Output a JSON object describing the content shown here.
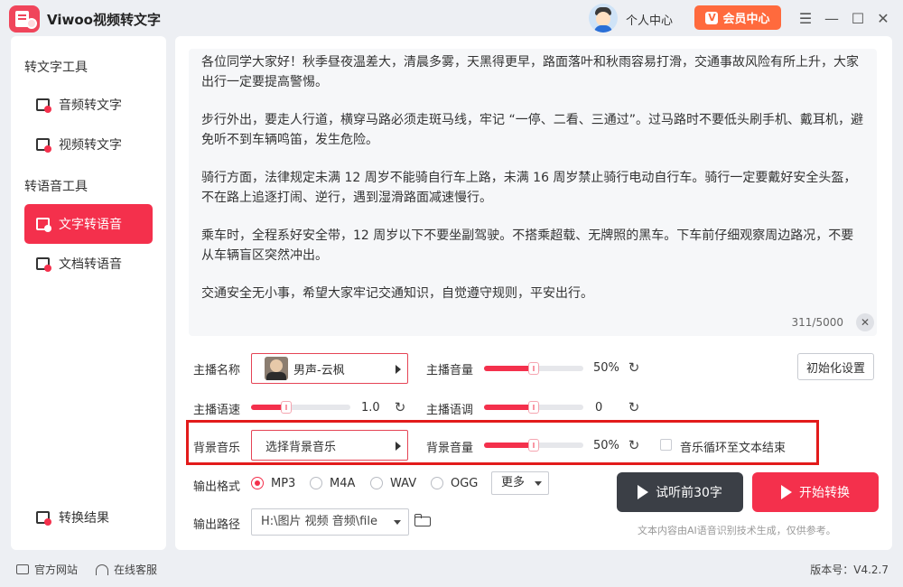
{
  "app": {
    "title": "Viwoo视频转文字"
  },
  "header": {
    "user_center": "个人中心",
    "vip": "会员中心",
    "vip_glyph": "V"
  },
  "window_controls": {
    "menu": "☰",
    "minimize": "—",
    "maximize": "☐",
    "close": "✕"
  },
  "sidebar": {
    "section_1": "转文字工具",
    "item_audio": "音频转文字",
    "item_video": "视频转文字",
    "section_2": "转语音工具",
    "item_text_tts": "文字转语音",
    "item_doc_tts": "文档转语音",
    "item_results": "转换结果"
  },
  "editor": {
    "paragraphs": [
      "各位同学大家好！秋季昼夜温差大，清晨多雾，天黑得更早，路面落叶和秋雨容易打滑，交通事故风险有所上升，大家出行一定要提高警惕。",
      "步行外出，要走人行道，横穿马路必须走斑马线，牢记 “一停、二看、三通过”。过马路时不要低头刷手机、戴耳机，避免听不到车辆鸣笛，发生危险。",
      "骑行方面，法律规定未满 12 周岁不能骑自行车上路，未满 16 周岁禁止骑行电动自行车。骑行一定要戴好安全头盔，不在路上追逐打闹、逆行，遇到湿滑路面减速慢行。",
      "乘车时，全程系好安全带，12 周岁以下不要坐副驾驶。不搭乘超载、无牌照的黑车。下车前仔细观察周边路况，不要从车辆盲区突然冲出。",
      "交通安全无小事，希望大家牢记交通知识，自觉遵守规则，平安出行。"
    ],
    "counter": "311/5000",
    "clear_glyph": "✕"
  },
  "settings": {
    "anchor_label": "主播名称",
    "anchor_value": "男声-云枫",
    "anchor_volume_label": "主播音量",
    "anchor_volume_value": "50%",
    "anchor_volume_level": 0.5,
    "init_button": "初始化设置",
    "speed_label": "主播语速",
    "speed_value": "1.0",
    "speed_level": 0.35,
    "pitch_label": "主播语调",
    "pitch_value": "0",
    "pitch_level": 0.5,
    "bgm_label": "背景音乐",
    "bgm_select": "选择背景音乐",
    "bgm_volume_label": "背景音量",
    "bgm_volume_value": "50%",
    "bgm_volume_level": 0.5,
    "loop_label": "音乐循环至文本结束",
    "reset_glyph": "↻"
  },
  "output": {
    "format_label": "输出格式",
    "formats": [
      "MP3",
      "M4A",
      "WAV",
      "OGG"
    ],
    "selected_format": "MP3",
    "more": "更多",
    "path_label": "输出路径",
    "path_value": "H:\\图片 视频 音频\\file"
  },
  "actions": {
    "try_button": "试听前30字",
    "start_button": "开始转换",
    "disclaimer": "文本内容由AI语音识别技术生成，仅供参考。"
  },
  "footer": {
    "website": "官方网站",
    "support": "在线客服",
    "version": "版本号：V4.2.7"
  },
  "colors": {
    "accent": "#f4304c",
    "vip": "#ff6a3d",
    "dark_button": "#3b3f46",
    "highlight_border": "#e21b1b"
  }
}
